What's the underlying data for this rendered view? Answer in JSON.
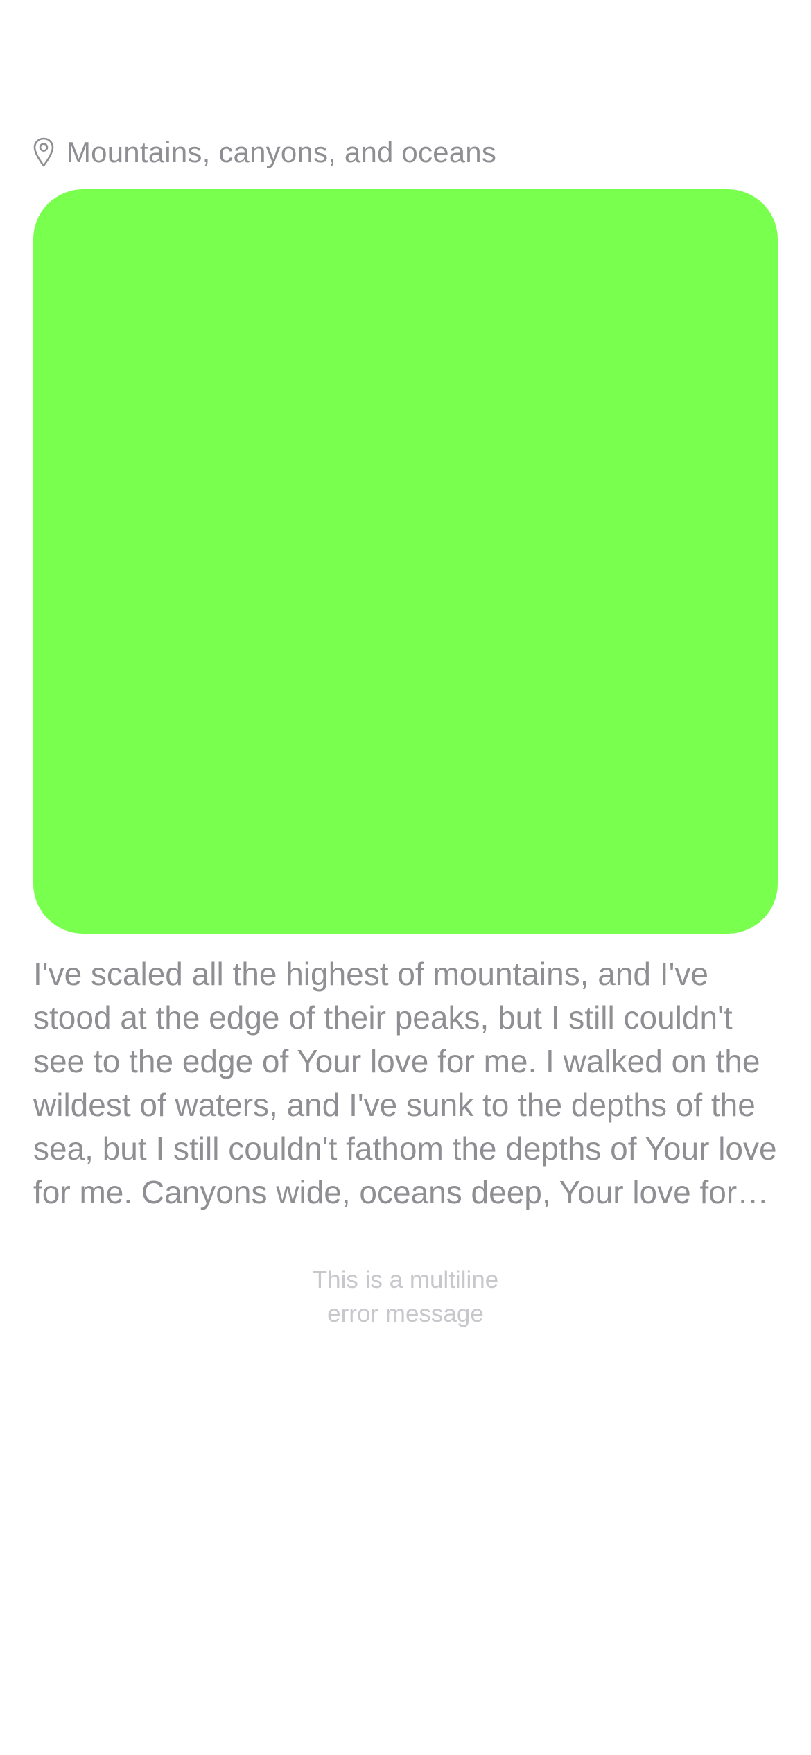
{
  "location": {
    "icon": "location-pin-icon",
    "label": "Mountains, canyons, and oceans"
  },
  "media": {
    "color": "#79ff4d"
  },
  "post": {
    "text": "I've scaled all the highest of mountains, and I've stood at the edge of their peaks, but I still couldn't see to the edge of Your love for me. I walked on the wildest of waters, and I've sunk to the depths of the sea, but I still couldn't fathom the depths of Your love for me. Canyons wide, oceans deep, Your love for me."
  },
  "error": {
    "lines": [
      "This is a multiline",
      "error message"
    ]
  },
  "colors": {
    "secondary_text": "#8e8e93",
    "tertiary_text": "#c7c7cc",
    "background": "#ffffff"
  }
}
